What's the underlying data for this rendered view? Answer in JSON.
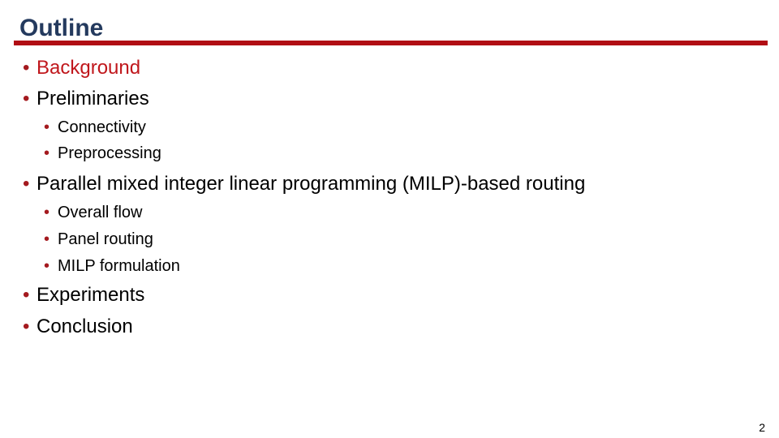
{
  "slide": {
    "title": "Outline",
    "bullet_char": "•",
    "items": [
      {
        "label": "Background",
        "level": 1,
        "active": true
      },
      {
        "label": "Preliminaries",
        "level": 1
      },
      {
        "label": "Connectivity",
        "level": 2
      },
      {
        "label": "Preprocessing",
        "level": 2
      },
      {
        "label": "Parallel mixed integer linear programming (MILP)-based routing",
        "level": 1
      },
      {
        "label": "Overall flow",
        "level": 2
      },
      {
        "label": "Panel routing",
        "level": 2
      },
      {
        "label": "MILP formulation",
        "level": 2
      },
      {
        "label": "Experiments",
        "level": 1
      },
      {
        "label": "Conclusion",
        "level": 1
      }
    ],
    "page_number": "2",
    "colors": {
      "title": "#243a5e",
      "rule": "#b10e14",
      "active": "#c0171c",
      "bullet": "#a41a1f"
    }
  }
}
